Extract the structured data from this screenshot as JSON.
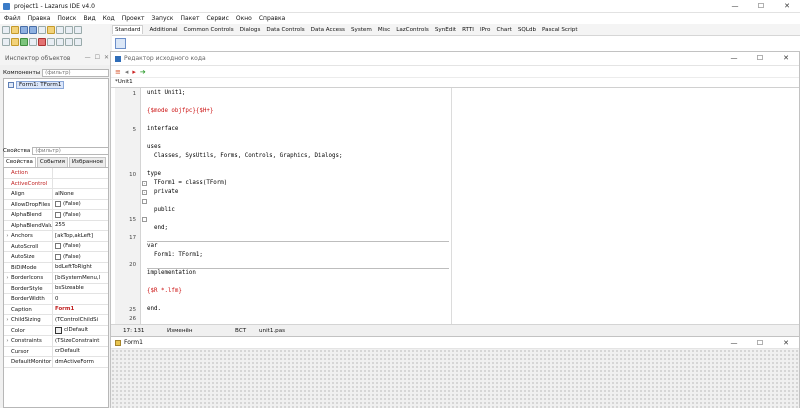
{
  "app": {
    "title": "project1 - Lazarus IDE v4.0"
  },
  "window_buttons": {
    "minimize": "—",
    "maximize": "☐",
    "close": "✕"
  },
  "menu": [
    "Файл",
    "Правка",
    "Поиск",
    "Вид",
    "Код",
    "Проект",
    "Запуск",
    "Пакет",
    "Сервис",
    "Окно",
    "Справка"
  ],
  "palette_tabs": [
    "Standard",
    "Additional",
    "Common Controls",
    "Dialogs",
    "Data Controls",
    "Data Access",
    "System",
    "Misc",
    "LazControls",
    "SynEdit",
    "RTTI",
    "IPro",
    "Chart",
    "SQLdb",
    "Pascal Script"
  ],
  "inspector": {
    "title": "Инспектор объектов",
    "components_label": "Компоненты",
    "components_filter": "(фильтр)",
    "tree_node": "Form1: TForm1",
    "props_label": "Свойства",
    "props_filter": "(фильтр)",
    "tabs": [
      "Свойства",
      "События",
      "Избранное"
    ],
    "properties": [
      {
        "exp": "",
        "name": "Action",
        "value": "",
        "red": true
      },
      {
        "exp": "",
        "name": "ActiveControl",
        "value": "",
        "red": true
      },
      {
        "exp": "",
        "name": "Align",
        "value": "alNone",
        "red": false
      },
      {
        "exp": "",
        "name": "AllowDropFiles",
        "value": "(False)",
        "red": false,
        "check": true
      },
      {
        "exp": "",
        "name": "AlphaBlend",
        "value": "(False)",
        "red": false,
        "check": true
      },
      {
        "exp": "",
        "name": "AlphaBlendValu",
        "value": "255",
        "red": false
      },
      {
        "exp": "›",
        "name": "Anchors",
        "value": "[akTop,akLeft]",
        "red": false
      },
      {
        "exp": "",
        "name": "AutoScroll",
        "value": "(False)",
        "red": false,
        "check": true
      },
      {
        "exp": "",
        "name": "AutoSize",
        "value": "(False)",
        "red": false,
        "check": true
      },
      {
        "exp": "",
        "name": "BiDiMode",
        "value": "bdLeftToRight",
        "red": false
      },
      {
        "exp": "›",
        "name": "BorderIcons",
        "value": "[biSystemMenu,l",
        "red": false
      },
      {
        "exp": "",
        "name": "BorderStyle",
        "value": "bsSizeable",
        "red": false
      },
      {
        "exp": "",
        "name": "BorderWidth",
        "value": "0",
        "red": false
      },
      {
        "exp": "",
        "name": "Caption",
        "value": "Form1",
        "red": false,
        "bold": true
      },
      {
        "exp": "›",
        "name": "ChildSizing",
        "value": "(TControlChildSi",
        "red": false
      },
      {
        "exp": "",
        "name": "Color",
        "value": "clDefault",
        "red": false,
        "swatch": true
      },
      {
        "exp": "›",
        "name": "Constraints",
        "value": "(TSizeConstraint",
        "red": false
      },
      {
        "exp": "",
        "name": "Cursor",
        "value": "crDefault",
        "red": false
      },
      {
        "exp": "",
        "name": "DefaultMonitor",
        "value": "dmActiveForm",
        "red": false
      }
    ]
  },
  "editor": {
    "title": "Редактор исходного кода",
    "tab": "*Unit1",
    "tool_icons": [
      "≡",
      "◂",
      "▸",
      "➔"
    ],
    "lines": [
      {
        "n": "1",
        "text": "unit Unit1;",
        "red": false
      },
      {
        "n": "",
        "text": "",
        "red": false
      },
      {
        "n": "",
        "text": "{$mode objfpc}{$H+}",
        "red": true
      },
      {
        "n": "",
        "text": "",
        "red": false
      },
      {
        "n": "5",
        "text": "interface",
        "red": false
      },
      {
        "n": "",
        "text": "",
        "red": false
      },
      {
        "n": "",
        "text": "uses",
        "red": false
      },
      {
        "n": "",
        "text": "  Classes, SysUtils, Forms, Controls, Graphics, Dialogs;",
        "red": false
      },
      {
        "n": "",
        "text": "",
        "red": false
      },
      {
        "n": "10",
        "text": "type",
        "red": false
      },
      {
        "n": "",
        "text": "  TForm1 = class(TForm)",
        "red": false
      },
      {
        "n": "",
        "text": "  private",
        "red": false
      },
      {
        "n": "",
        "text": "",
        "red": false
      },
      {
        "n": "",
        "text": "  public",
        "red": false
      },
      {
        "n": "15",
        "text": "",
        "red": false
      },
      {
        "n": "",
        "text": "  end;",
        "red": false
      },
      {
        "n": "17",
        "text": "",
        "red": false
      },
      {
        "n": "",
        "text": "var",
        "red": false
      },
      {
        "n": "",
        "text": "  Form1: TForm1;",
        "red": false
      },
      {
        "n": "20",
        "text": "",
        "red": false
      },
      {
        "n": "",
        "text": "implementation",
        "red": false
      },
      {
        "n": "",
        "text": "",
        "red": false
      },
      {
        "n": "",
        "text": "{$R *.lfm}",
        "red": true
      },
      {
        "n": "",
        "text": "",
        "red": false
      },
      {
        "n": "25",
        "text": "end.",
        "red": false
      },
      {
        "n": "26",
        "text": "",
        "red": false
      }
    ],
    "status": {
      "pos": "17: 131",
      "modified": "Изменён",
      "ins": "ВСТ",
      "file": "unit1.pas"
    }
  },
  "form": {
    "title": "Form1"
  }
}
